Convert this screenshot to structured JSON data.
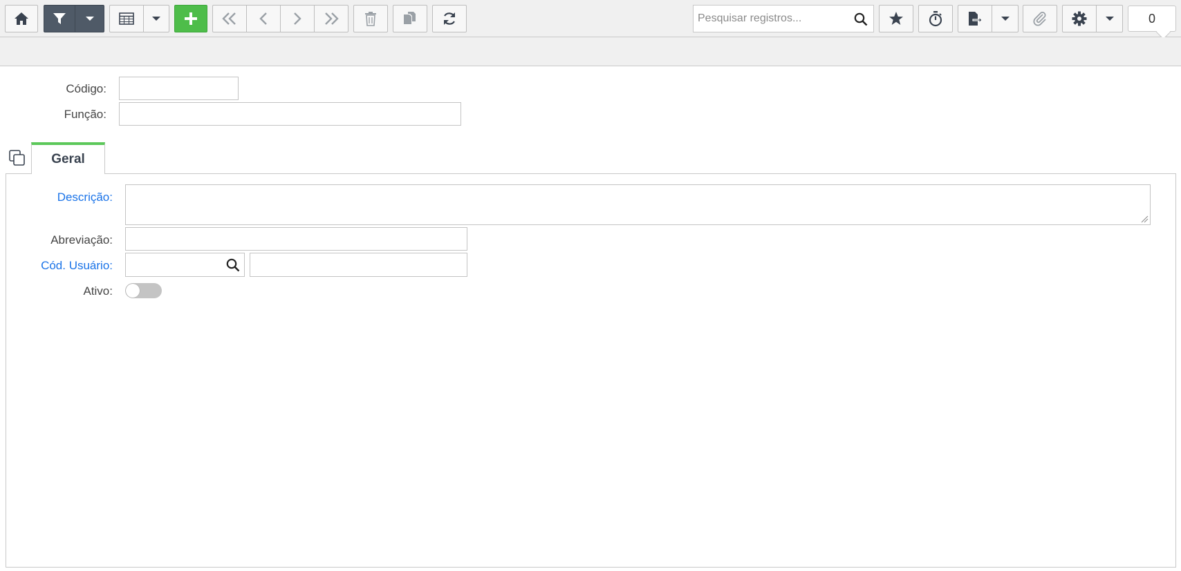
{
  "toolbar": {
    "search_placeholder": "Pesquisar registros...",
    "counter": "0"
  },
  "header": {
    "codigo_label": "Código:",
    "funcao_label": "Função:"
  },
  "tabs": [
    {
      "label": "Geral"
    }
  ],
  "form": {
    "descricao_label": "Descrição:",
    "abreviacao_label": "Abreviação:",
    "cod_usuario_label": "Cód. Usuário:",
    "ativo_label": "Ativo:"
  },
  "colors": {
    "accent_green": "#4ebd4a",
    "dark_button": "#4f5a67",
    "required_label": "#1a73e8"
  },
  "icons": [
    "home-icon",
    "filter-icon",
    "table-icon",
    "plus-icon",
    "first-icon",
    "prev-icon",
    "next-icon",
    "last-icon",
    "trash-icon",
    "copy-icon",
    "refresh-icon",
    "search-icon",
    "star-icon",
    "stopwatch-icon",
    "export-icon",
    "paperclip-icon",
    "gear-icon"
  ]
}
